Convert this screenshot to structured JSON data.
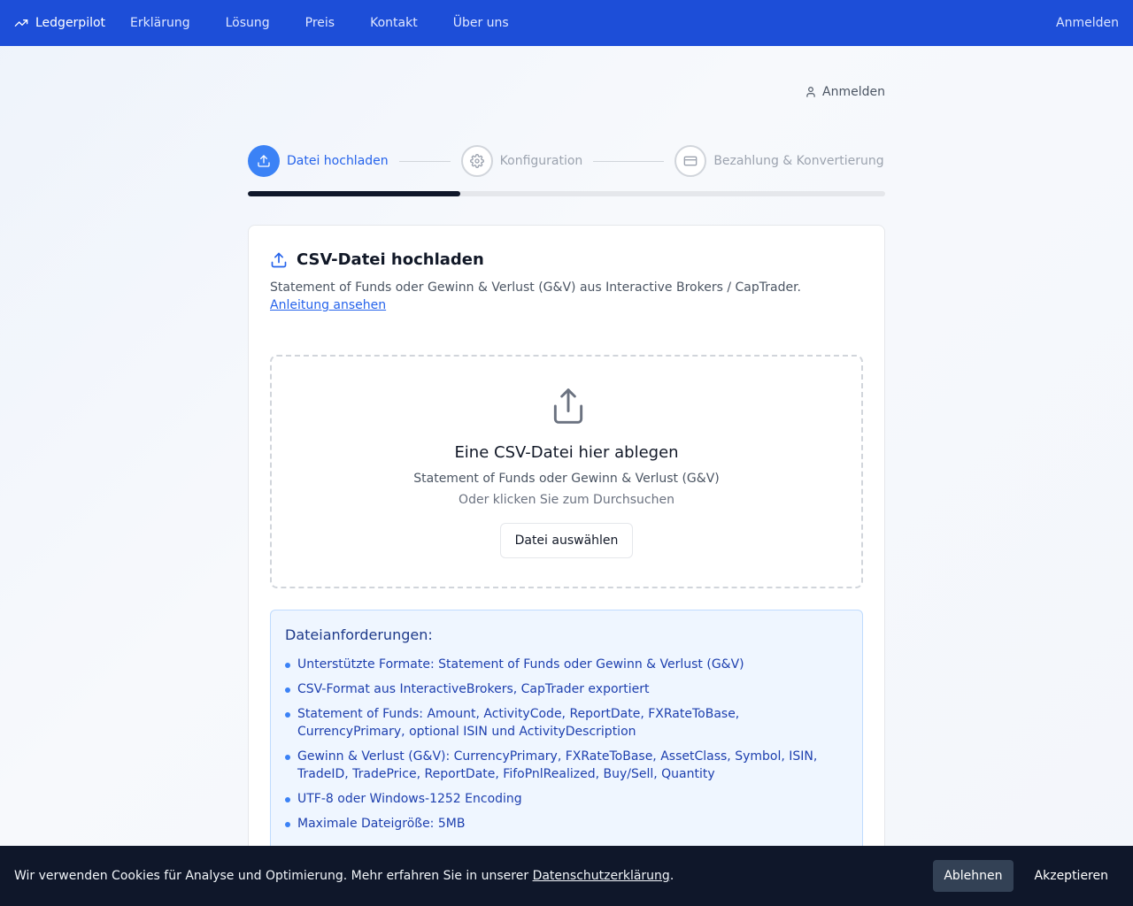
{
  "nav": {
    "brand": "Ledgerpilot",
    "links": [
      "Erklärung",
      "Lösung",
      "Preis",
      "Kontakt",
      "Über uns"
    ],
    "login": "Anmelden"
  },
  "page": {
    "login_link": "Anmelden"
  },
  "stepper": {
    "steps": [
      {
        "label": "Datei hochladen",
        "icon": "upload-icon",
        "state": "active"
      },
      {
        "label": "Konfiguration",
        "icon": "gear-icon",
        "state": "inactive"
      },
      {
        "label": "Bezahlung & Konvertierung",
        "icon": "credit-card-icon",
        "state": "inactive"
      }
    ],
    "progress_fraction": 0.333
  },
  "card": {
    "title": "CSV-Datei hochladen",
    "description": "Statement of Funds oder Gewinn & Verlust (G&V) aus Interactive Brokers / CapTrader.",
    "guide_link": "Anleitung ansehen",
    "dropzone": {
      "title": "Eine CSV-Datei hier ablegen",
      "subtitle": "Statement of Funds oder Gewinn & Verlust (G&V)",
      "hint": "Oder klicken Sie zum Durchsuchen",
      "button": "Datei auswählen"
    },
    "requirements": {
      "title": "Dateianforderungen:",
      "items": [
        "Unterstützte Formate: Statement of Funds oder Gewinn & Verlust (G&V)",
        "CSV-Format aus InteractiveBrokers, CapTrader exportiert",
        "Statement of Funds: Amount, ActivityCode, ReportDate, FXRateToBase, CurrencyPrimary, optional ISIN und ActivityDescription",
        "Gewinn & Verlust (G&V): CurrencyPrimary, FXRateToBase, AssetClass, Symbol, ISIN, TradeID, TradePrice, ReportDate, FifoPnlRealized, Buy/Sell, Quantity",
        "UTF-8 oder Windows-1252 Encoding",
        "Maximale Dateigröße: 5MB"
      ]
    }
  },
  "cookie": {
    "text_before": "Wir verwenden Cookies für Analyse und Optimierung. Mehr erfahren Sie in unserer ",
    "link": "Datenschutzerklärung",
    "text_after": ".",
    "decline": "Ablehnen",
    "accept": "Akzeptieren"
  },
  "colors": {
    "nav_bg": "#1d4ed8",
    "accent": "#3b82f6",
    "cookie_bg": "#0f172a"
  }
}
